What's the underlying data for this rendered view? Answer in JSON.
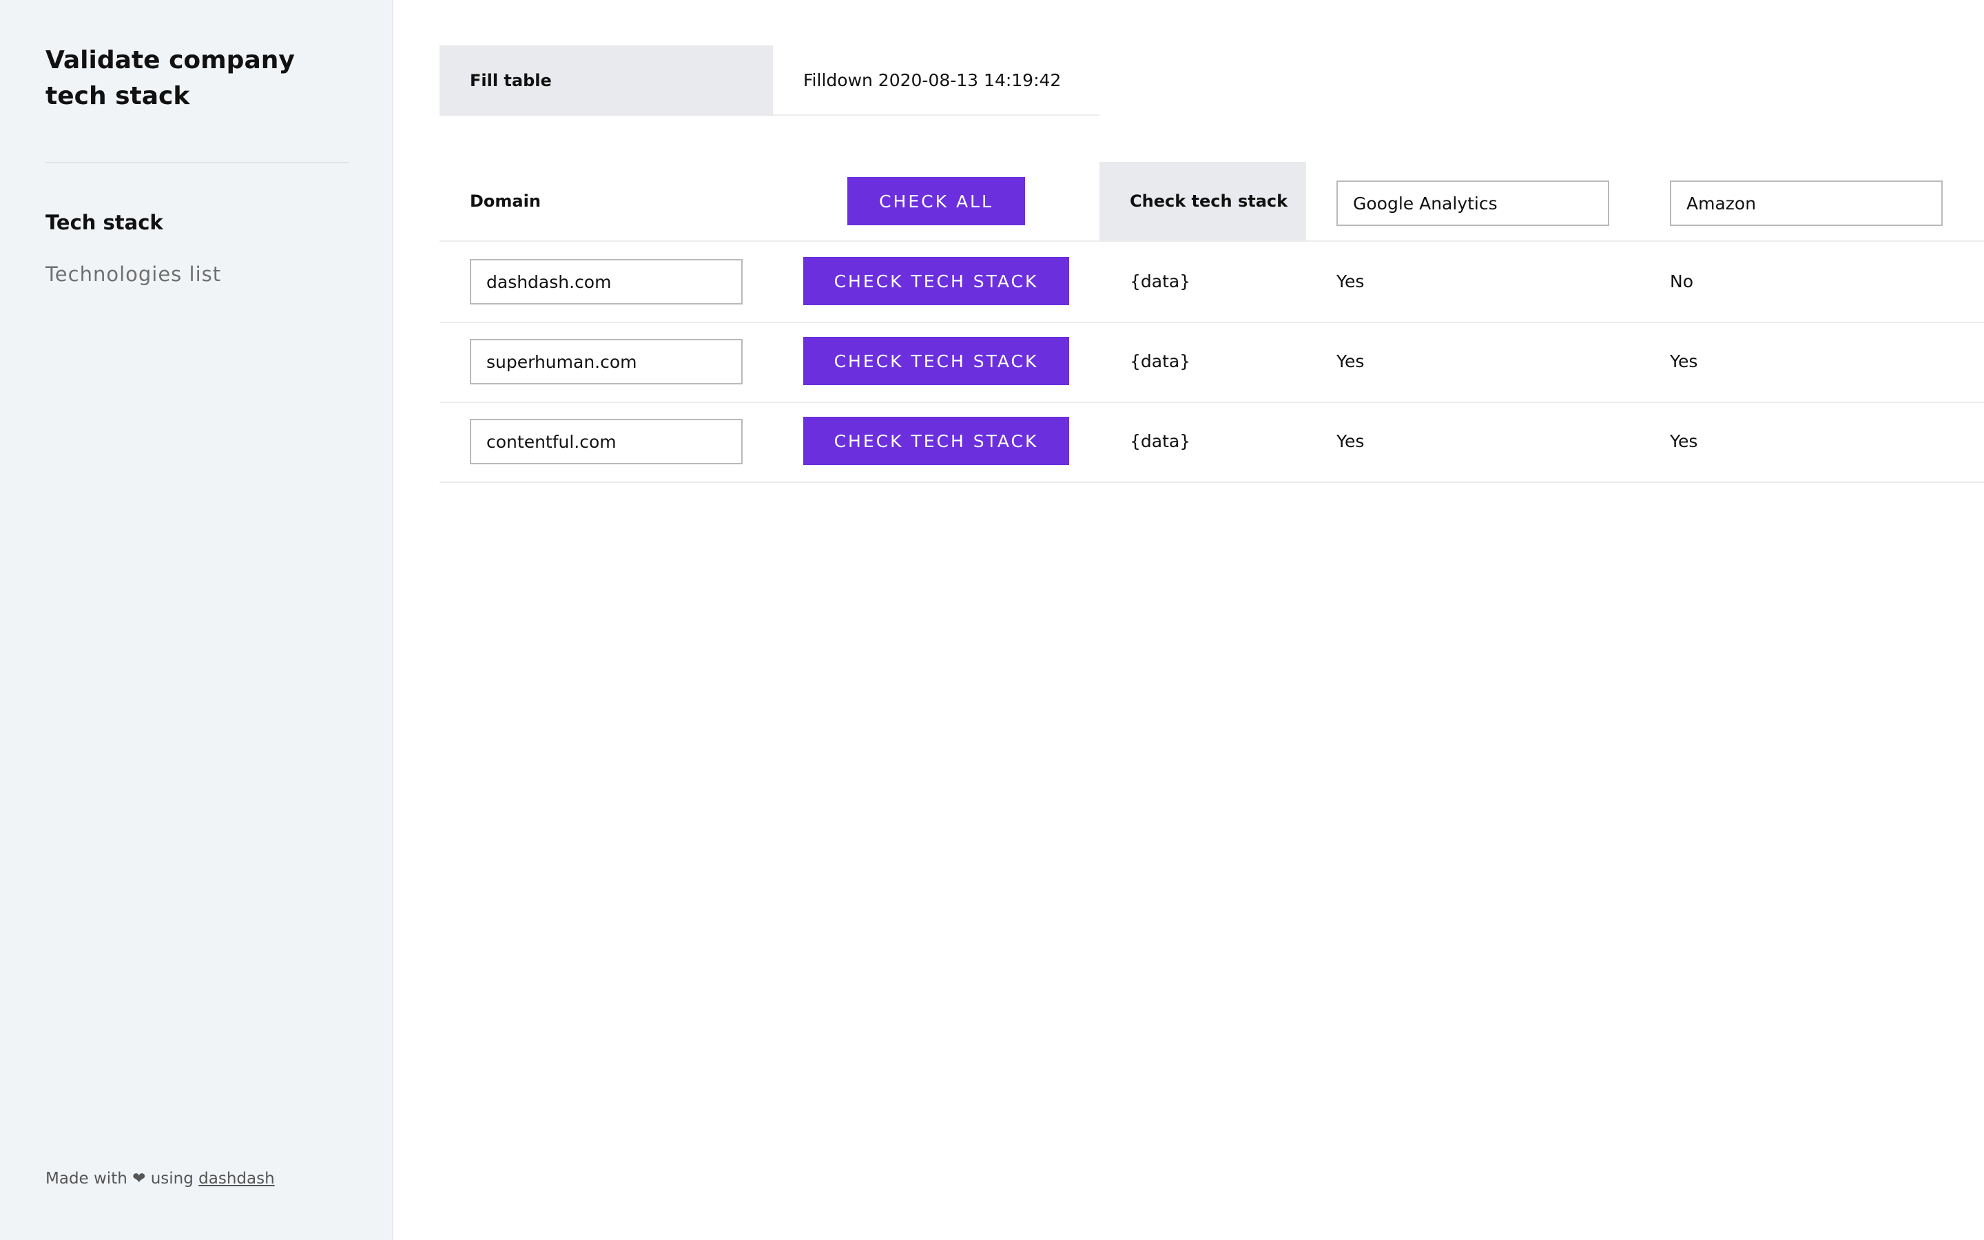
{
  "sidebar": {
    "title": "Validate company tech stack",
    "nav": [
      {
        "label": "Tech stack",
        "active": true
      },
      {
        "label": "Technologies list",
        "active": false
      }
    ],
    "footer": {
      "prefix": "Made with",
      "heart": "❤",
      "middle": "using",
      "link": "dashdash"
    }
  },
  "fill": {
    "label": "Fill table",
    "value": "Filldown 2020-08-13 14:19:42"
  },
  "table": {
    "header": {
      "domain": "Domain",
      "check_all": "Check all",
      "check_tech_stack": "Check tech stack",
      "tech_1": "Google Analytics",
      "tech_2": "Amazon"
    },
    "rows": [
      {
        "domain": "dashdash.com",
        "button": "Check tech stack",
        "check": "{data}",
        "tech_1": "Yes",
        "tech_2": "No"
      },
      {
        "domain": "superhuman.com",
        "button": "Check tech stack",
        "check": "{data}",
        "tech_1": "Yes",
        "tech_2": "Yes"
      },
      {
        "domain": "contentful.com",
        "button": "Check tech stack",
        "check": "{data}",
        "tech_1": "Yes",
        "tech_2": "Yes"
      }
    ]
  },
  "colors": {
    "accent": "#6b2fde",
    "sidebar_bg": "#f1f4f7",
    "header_cell_bg": "#e9eaed"
  }
}
